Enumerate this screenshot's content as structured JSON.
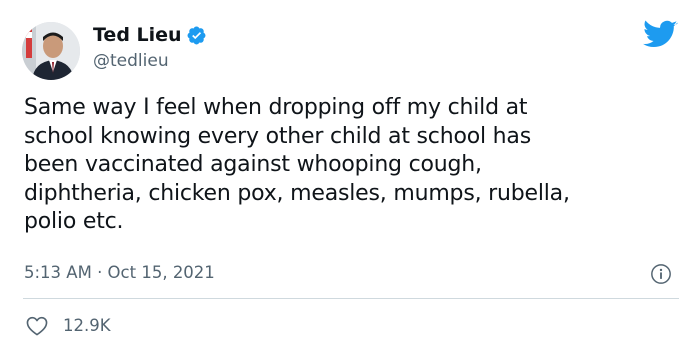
{
  "tweet": {
    "author": {
      "display_name": "Ted Lieu",
      "handle": "@tedlieu",
      "verified": true,
      "avatar_icon": "profile-photo"
    },
    "platform_icon": "twitter-bird-icon",
    "body_lines": [
      "Same way I feel when dropping off my child at",
      "school knowing every other child at school has",
      "been vaccinated against whooping cough,",
      "diphtheria, chicken pox, measles, mumps, rubella,",
      "polio etc."
    ],
    "timestamp": "5:13 AM · Oct 15, 2021",
    "info_icon": "info-icon",
    "likes": {
      "icon": "heart-icon",
      "count": "12.9K"
    },
    "colors": {
      "text": "#0f1419",
      "muted": "#536471",
      "accent": "#1d9bf0",
      "divider": "#cfd9de"
    }
  }
}
